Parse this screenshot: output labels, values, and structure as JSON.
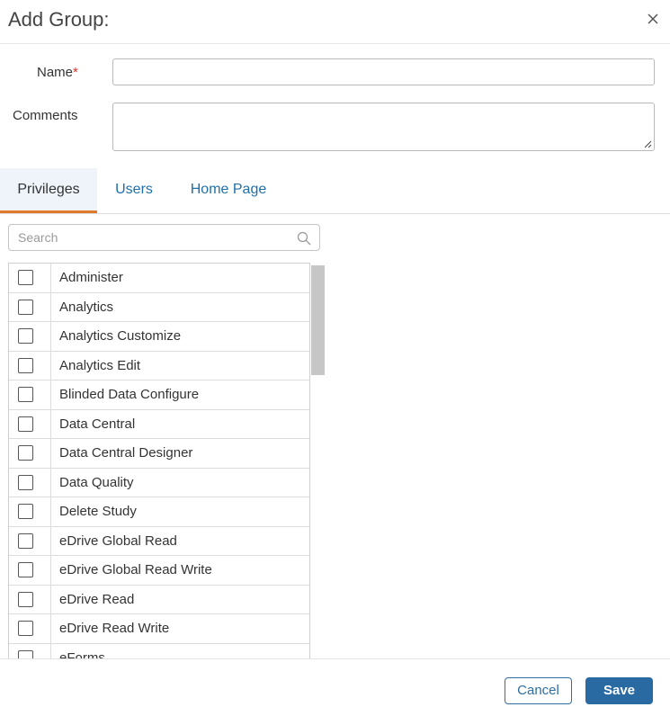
{
  "dialog": {
    "title": "Add Group:",
    "close_icon": "close-icon"
  },
  "form": {
    "name_label": "Name",
    "name_required_mark": "*",
    "name_value": "",
    "comments_label": "Comments",
    "comments_value": ""
  },
  "tabs": [
    {
      "label": "Privileges",
      "active": true
    },
    {
      "label": "Users",
      "active": false
    },
    {
      "label": "Home Page",
      "active": false
    }
  ],
  "search": {
    "placeholder": "Search",
    "icon": "search-icon"
  },
  "privileges": [
    {
      "label": "Administer",
      "checked": false
    },
    {
      "label": "Analytics",
      "checked": false
    },
    {
      "label": "Analytics Customize",
      "checked": false
    },
    {
      "label": "Analytics Edit",
      "checked": false
    },
    {
      "label": "Blinded Data Configure",
      "checked": false
    },
    {
      "label": "Data Central",
      "checked": false
    },
    {
      "label": "Data Central Designer",
      "checked": false
    },
    {
      "label": "Data Quality",
      "checked": false
    },
    {
      "label": "Delete Study",
      "checked": false
    },
    {
      "label": "eDrive Global Read",
      "checked": false
    },
    {
      "label": "eDrive Global Read Write",
      "checked": false
    },
    {
      "label": "eDrive Read",
      "checked": false
    },
    {
      "label": "eDrive Read Write",
      "checked": false
    },
    {
      "label": "eForms",
      "checked": false
    }
  ],
  "footer": {
    "cancel_label": "Cancel",
    "save_label": "Save"
  },
  "colors": {
    "accent": "#2a6aa3",
    "tab_active_underline": "#e07a2c",
    "link": "#1f6fa8",
    "required": "#d9342b"
  }
}
